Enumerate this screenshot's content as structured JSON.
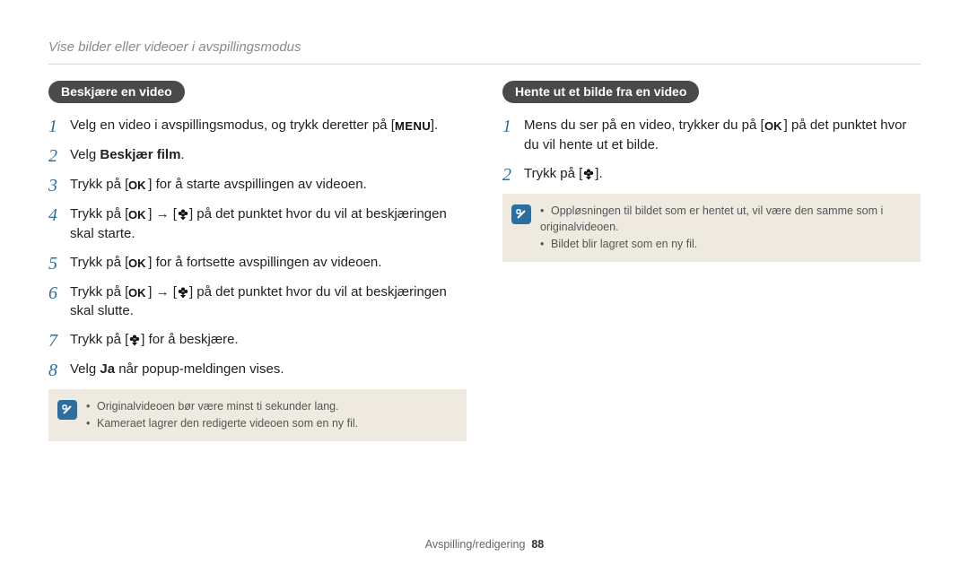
{
  "header": {
    "breadcrumb": "Vise bilder eller videoer i avspillingsmodus"
  },
  "left": {
    "pill": "Beskjære en video",
    "steps": [
      {
        "pre": "Velg en video i avspillingsmodus, og trykk deretter på [",
        "icon": "MENU",
        "post": "]."
      },
      {
        "pre": "Velg ",
        "bold": "Beskjær film",
        "post": "."
      },
      {
        "pre": "Trykk på [",
        "icon": "OK",
        "post": "] for å starte avspillingen av videoen."
      },
      {
        "pre": "Trykk på [",
        "icon": "OK",
        "mid": "] → [",
        "icon2": "FLOWER_DOWN",
        "post": "] på det punktet hvor du vil at beskjæringen skal starte."
      },
      {
        "pre": "Trykk på [",
        "icon": "OK",
        "post": "] for å fortsette avspillingen av videoen."
      },
      {
        "pre": "Trykk på [",
        "icon": "OK",
        "mid": "] → [",
        "icon2": "FLOWER_DOWN",
        "post": "] på det punktet hvor du vil at beskjæringen skal slutte."
      },
      {
        "pre": "Trykk på [",
        "icon": "FLOWER_DOWN",
        "post": "] for å beskjære."
      },
      {
        "pre": "Velg ",
        "bold": "Ja",
        "post": " når popup-meldingen vises."
      }
    ],
    "notes": [
      "Originalvideoen bør være minst ti sekunder lang.",
      "Kameraet lagrer den redigerte videoen som en ny fil."
    ]
  },
  "right": {
    "pill": "Hente ut et bilde fra en video",
    "steps": [
      {
        "pre": "Mens du ser på en video, trykker du på [",
        "icon": "OK",
        "post": "] på det punktet hvor du vil hente ut et bilde."
      },
      {
        "pre": "Trykk på [",
        "icon": "FLOWER_DOWN",
        "post": "]."
      }
    ],
    "notes": [
      "Oppløsningen til bildet som er hentet ut, vil være den samme som i originalvideoen.",
      "Bildet blir lagret som en ny fil."
    ]
  },
  "footer": {
    "section": "Avspilling/redigering",
    "page": "88"
  },
  "icons": {
    "MENU": "menu-icon",
    "OK": "ok-icon",
    "FLOWER_DOWN": "flower-down-icon",
    "NOTE": "note-info-icon"
  }
}
